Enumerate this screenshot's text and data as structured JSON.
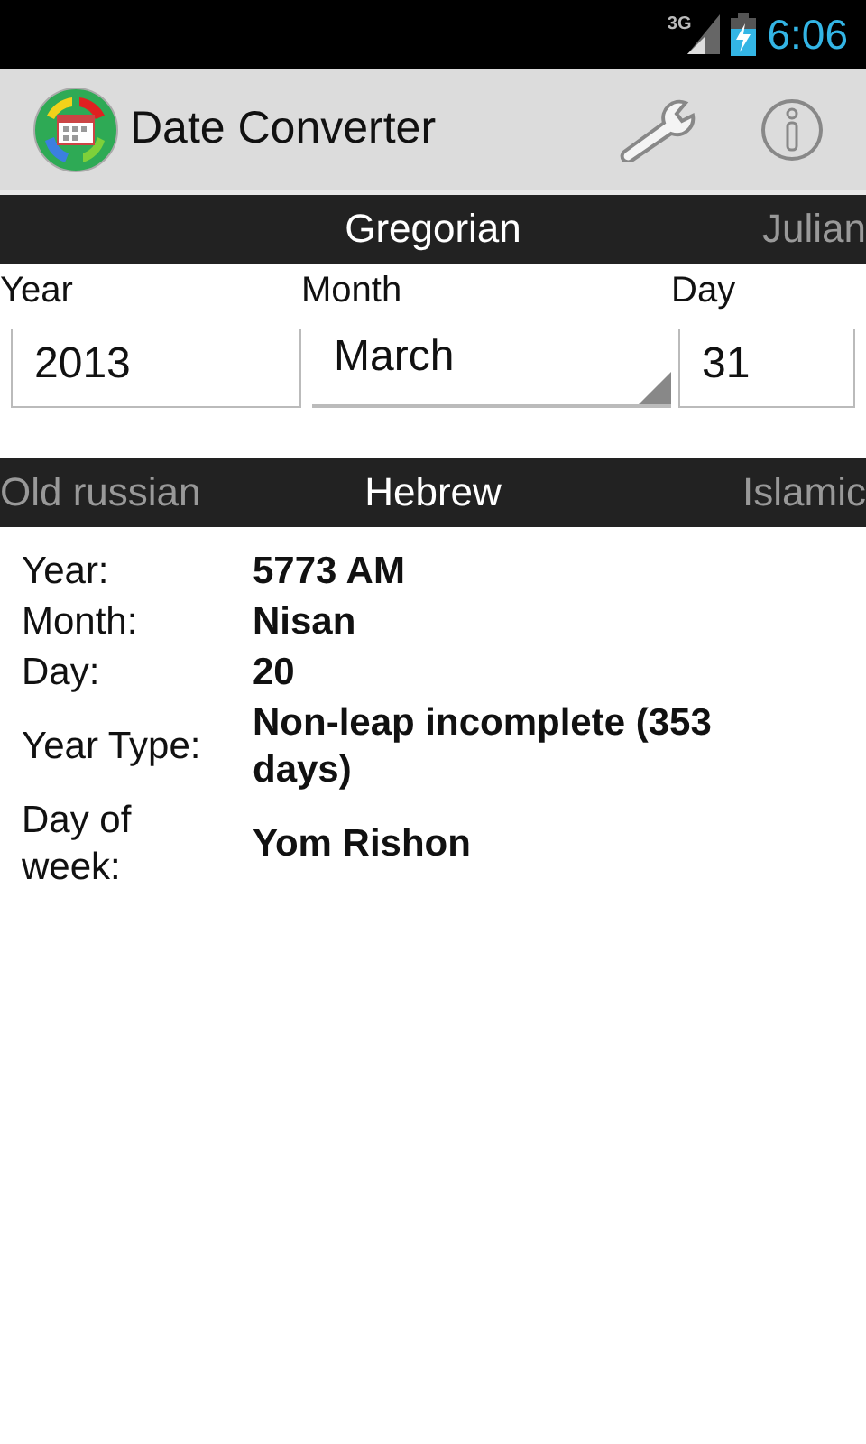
{
  "status_bar": {
    "network": "3G",
    "time": "6:06"
  },
  "action_bar": {
    "title": "Date Converter"
  },
  "source_tabs": [
    {
      "label": "Gregorian",
      "selected": true
    },
    {
      "label": "Julian",
      "selected": false
    }
  ],
  "input": {
    "fields": [
      {
        "kind": "text",
        "label": "Year",
        "value": "2013"
      },
      {
        "kind": "dropdown",
        "label": "Month",
        "value": "March"
      },
      {
        "kind": "text",
        "label": "Day",
        "value": "31"
      }
    ]
  },
  "target_tabs": [
    {
      "label": "Old russian",
      "selected": false
    },
    {
      "label": "Hebrew",
      "selected": true
    },
    {
      "label": "Islamic",
      "selected": false
    }
  ],
  "result": [
    {
      "label": "Year:",
      "value": "5773 AM"
    },
    {
      "label": "Month:",
      "value": "Nisan"
    },
    {
      "label": "Day:",
      "value": "20"
    },
    {
      "label": "Year Type:",
      "value": "Non-leap incomplete (353 days)"
    },
    {
      "label": "Day of week:",
      "value": "Yom Rishon"
    }
  ]
}
